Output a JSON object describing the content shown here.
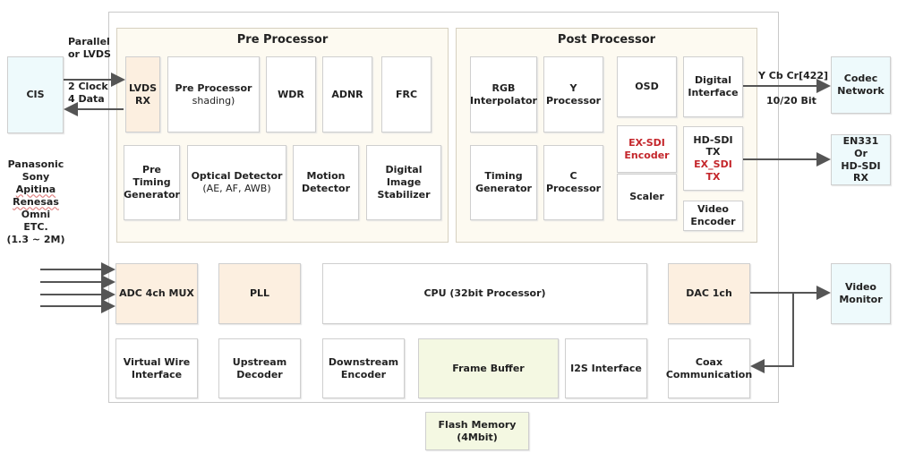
{
  "pre_processor": {
    "title": "Pre Processor",
    "lvds_rx": "LVDS RX",
    "pre_processor_block": {
      "line1": "Pre Processor",
      "line2": "shading)"
    },
    "wdr": "WDR",
    "adnr": "ADNR",
    "frc": "FRC",
    "pre_timing_generator": "Pre Timing Generator",
    "optical_detector": {
      "line1": "Optical Detector",
      "line2": "(AE, AF, AWB)"
    },
    "motion_detector": "Motion Detector",
    "digital_image_stabilizer": "Digital Image Stabilizer"
  },
  "post_processor": {
    "title": "Post Processor",
    "rgb_interpolator": "RGB Interpolator",
    "y_processor": "Y Processor",
    "osd": "OSD",
    "digital_interface": "Digital Interface",
    "timing_generator": "Timing Generator",
    "c_processor": "C Processor",
    "ex_sdi_encoder": "EX-SDI Encoder",
    "scaler": "Scaler",
    "hd_sdi_tx": {
      "line1": "HD-SDI TX",
      "line2": "EX_SDI TX"
    },
    "video_encoder": "Video Encoder"
  },
  "bottom": {
    "adc": "ADC 4ch MUX",
    "pll": "PLL",
    "cpu": "CPU (32bit Processor)",
    "dac": "DAC 1ch",
    "virtual_wire": "Virtual Wire Interface",
    "upstream": "Upstream Decoder",
    "downstream": "Downstream Encoder",
    "frame_buffer": "Frame Buffer",
    "i2s": "I2S Interface",
    "coax": "Coax Communication",
    "flash": "Flash Memory (4Mbit)"
  },
  "external": {
    "cis": "CIS",
    "codec_network": "Codec Network",
    "en331": {
      "line1": "EN331",
      "line2": "Or",
      "line3": "HD-SDI RX"
    },
    "video_monitor": "Video Monitor"
  },
  "labels": {
    "parallel": "Parallel",
    "or_lvds": "or LVDS",
    "clock": "2 Clock",
    "data": "4 Data",
    "ycbcr": "Y Cb Cr[422]",
    "bits": "10/20 Bit",
    "vendors": [
      "Panasonic",
      "Sony",
      "Apitina",
      "Renesas",
      "Omni",
      "ETC.",
      "(1.3 ~ 2M)"
    ]
  },
  "colors": {
    "accent_red": "#c4262b",
    "peach": "#fcefe0",
    "light_blue": "#eefafc",
    "light_green": "#f4f8e2",
    "panel": "#fdfaf1"
  }
}
